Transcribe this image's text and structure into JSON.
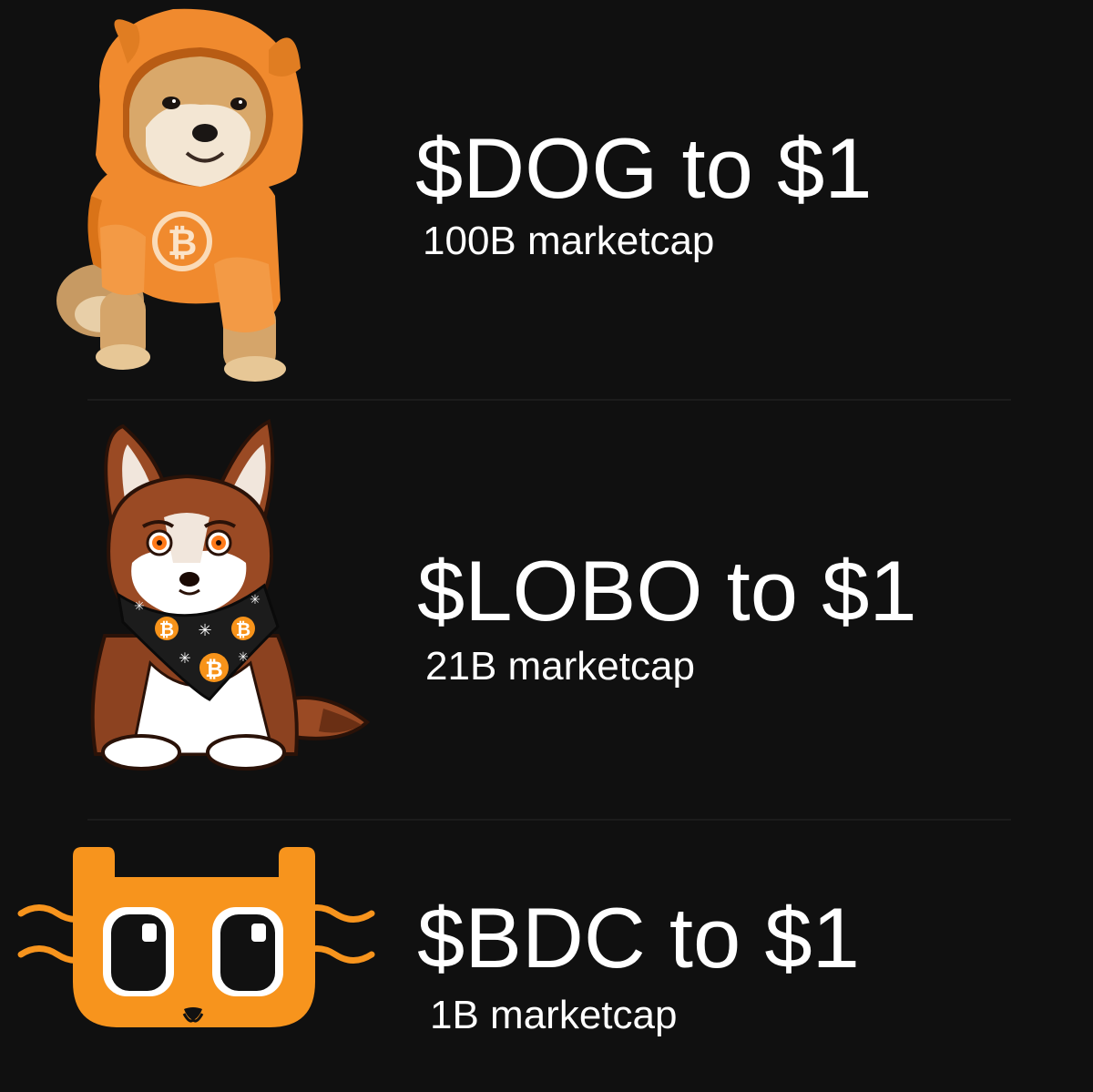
{
  "rows": [
    {
      "title": "$DOG to $1",
      "subtitle": "100B marketcap"
    },
    {
      "title": "$LOBO to $1",
      "subtitle": "21B marketcap"
    },
    {
      "title": "$BDC to $1",
      "subtitle": "1B marketcap"
    }
  ],
  "colors": {
    "background": "#101010",
    "text": "#ffffff",
    "hoodie_orange": "#f08a2e",
    "wolf_brown": "#9a4a24",
    "cat_orange": "#f7941d",
    "divider": "#1c1c1c"
  },
  "icons": [
    "dog-in-bitcoin-hoodie-image",
    "wolf-with-bitcoin-bandana-illustration",
    "orange-cat-face-logo",
    "bitcoin-icon"
  ]
}
